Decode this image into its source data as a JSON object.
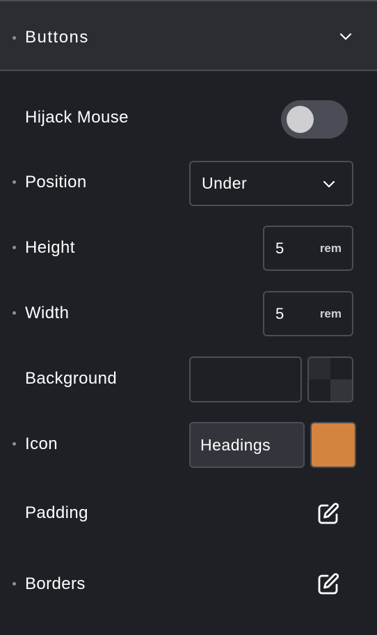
{
  "section": {
    "title": "Buttons",
    "icon": "chevron-down-icon"
  },
  "rows": {
    "hijack_mouse": {
      "label": "Hijack Mouse",
      "toggle_on": false
    },
    "position": {
      "label": "Position",
      "value": "Under",
      "icon": "chevron-down-icon"
    },
    "height": {
      "label": "Height",
      "value": "5",
      "unit": "rem"
    },
    "width": {
      "label": "Width",
      "value": "5",
      "unit": "rem"
    },
    "background": {
      "label": "Background",
      "value": "",
      "swatch": "transparent"
    },
    "icon": {
      "label": "Icon",
      "value": "Headings",
      "swatch_color": "#d4843e"
    },
    "padding": {
      "label": "Padding",
      "icon": "edit-icon"
    },
    "borders": {
      "label": "Borders",
      "icon": "edit-icon"
    }
  },
  "colors": {
    "panel_bg": "#1f2025",
    "header_bg": "#2b2d33",
    "border": "#4b4e55",
    "toggle_track": "#4a4d55",
    "toggle_knob": "#cfcfd1",
    "accent_orange": "#d4843e"
  }
}
